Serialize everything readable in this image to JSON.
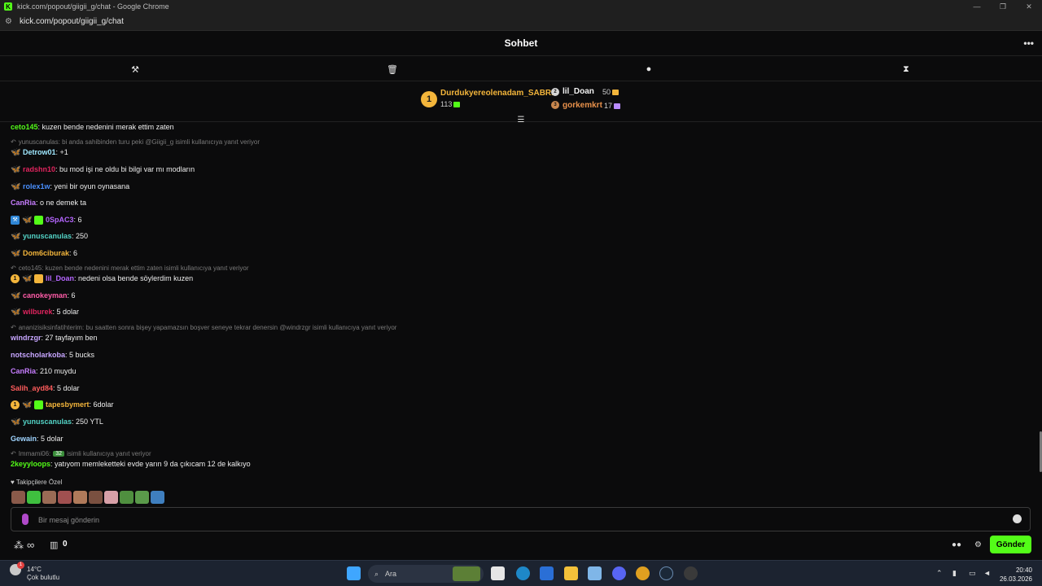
{
  "window": {
    "title": "kick.com/popout/giigii_g/chat - Google Chrome",
    "url": "kick.com/popout/giigii_g/chat",
    "controls": [
      "—",
      "❐",
      "✕"
    ]
  },
  "chat": {
    "title": "Sohbet",
    "menu_icon": "more-icon"
  },
  "leaderboard": {
    "first": {
      "rank": "1",
      "name": "Durdukyereolenadam_SABRI",
      "count": "113"
    },
    "second": {
      "name": "lil_Doan",
      "count": "50"
    },
    "third": {
      "name": "gorkemkrt",
      "count": "17"
    }
  },
  "messages": [
    {
      "user": "ceto145",
      "text": ": kuzen bende nedenini merak ettim zaten",
      "color": "#53fc18",
      "top": 0
    },
    {
      "reply": "yunuscanulas: bi anda sahibinden turu peki @Giigii_g isimli kullanıcıya yanıt veriyor"
    },
    {
      "user": "Detrow01",
      "text": ": +1",
      "color": "#9fe8ff"
    },
    {
      "user": "radshn10",
      "text": ": bu mod işi ne oldu bi bilgi var mı modların",
      "color": "#e0245e"
    },
    {
      "user": "rolex1w",
      "text": ": yeni bir oyun oynasana",
      "color": "#4a90ff"
    },
    {
      "user": "CanRia",
      "text": ": o ne demek ta",
      "color": "#c77dff"
    },
    {
      "user": "0SpAC3",
      "text": ": 6",
      "color": "#b566ff"
    },
    {
      "user": "yunuscanulas",
      "text": ": 250",
      "color": "#53d3c6"
    },
    {
      "user": "Dom6ciburak",
      "text": ": 6",
      "color": "#f3b53b"
    },
    {
      "reply": "ceto145: kuzen bende nedenini merak ettim zaten isimli kullanıcıya yanıt veriyor"
    },
    {
      "user": "lil_Doan",
      "text": ": nedeni olsa bende söylerdim kuzen",
      "color": "#b566ff"
    },
    {
      "user": "canokeyman",
      "text": ": 6",
      "color": "#ff5ca8"
    },
    {
      "user": "wilburek",
      "text": ": 5 dolar",
      "color": "#e0245e"
    },
    {
      "reply": "ananizisiksinfatihterim: bu saatten sonra bişey yapamazsın boşver seneye tekrar denersin @windrzgr isimli kullanıcıya yanıt veriyor"
    },
    {
      "user": "windrzgr",
      "text": ": 27 tayfayım ben",
      "color": "#c7a6ff"
    },
    {
      "user": "notscholarkoba",
      "text": ": 5 bucks",
      "color": "#c7a6ff"
    },
    {
      "user": "CanRia",
      "text": ": 210 muydu",
      "color": "#c77dff"
    },
    {
      "user": "Salih_ayd84",
      "text": ": 5 dolar",
      "color": "#ff5c5c"
    },
    {
      "user": "tapesbymert",
      "text": ": 6dolar",
      "color": "#f3b53b"
    },
    {
      "user": "yunuscanulas",
      "text": ": 250 YTL",
      "color": "#53d3c6"
    },
    {
      "user": "Gewain",
      "text": ": 5 dolar",
      "color": "#9fd4ff"
    },
    {
      "reply": "Immami06:",
      "reply2": "isimli kullanıcıya yanıt veriyor",
      "pill": "32"
    },
    {
      "user": "2keyyloops",
      "text": ": yatıyom memleketteki evde yarın 9 da çıkıcam 12 de kalkıyo",
      "color": "#53fc18"
    }
  ],
  "followers_label": "Takipçilere Özel",
  "input": {
    "placeholder": "Bir mesaj gönderin"
  },
  "footer": {
    "infinity": "∞",
    "points": "0",
    "send": "Gönder"
  },
  "taskbar": {
    "temp": "14°C",
    "weather": "Çok bulutlu",
    "badge": "1",
    "search": "Ara",
    "time": "20:40",
    "date": "26.03.2026"
  }
}
